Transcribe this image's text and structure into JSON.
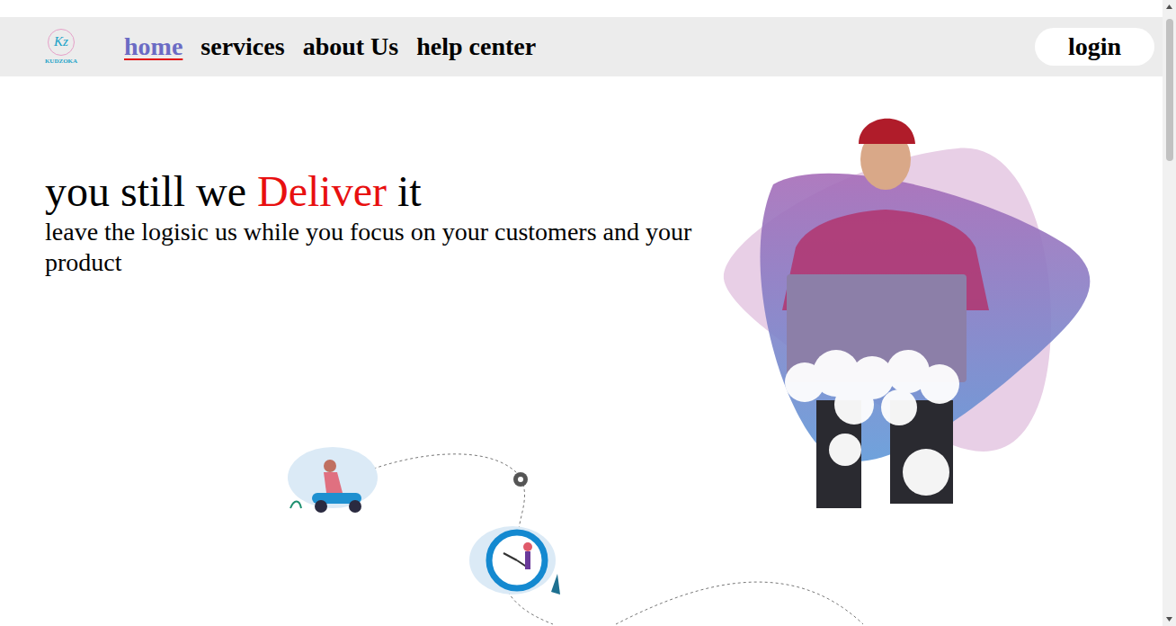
{
  "logo": {
    "mark": "Kz",
    "name": "KUDZOKA"
  },
  "nav": [
    {
      "label": "home",
      "selected": true
    },
    {
      "label": "services",
      "selected": false
    },
    {
      "label": "about Us",
      "selected": false
    },
    {
      "label": "help center",
      "selected": false
    }
  ],
  "login": "login",
  "hero": {
    "title": [
      {
        "text": "you still we ",
        "highlight": false
      },
      {
        "text": "Deliver",
        "highlight": true
      },
      {
        "text": " it",
        "highlight": false
      }
    ],
    "subtitle": "leave the logisic us while you focus on your customers and your product"
  }
}
